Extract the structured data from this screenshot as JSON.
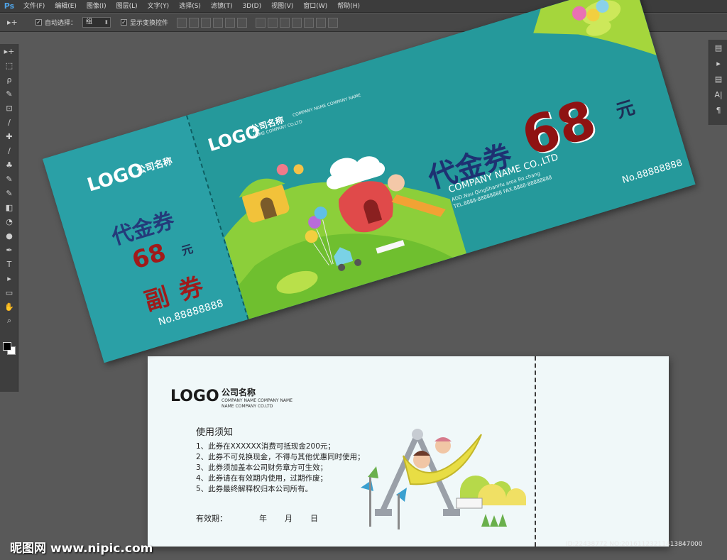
{
  "app": {
    "logo": "Ps"
  },
  "menu": [
    "文件(F)",
    "编辑(E)",
    "图像(I)",
    "图层(L)",
    "文字(Y)",
    "选择(S)",
    "滤镜(T)",
    "3D(D)",
    "视图(V)",
    "窗口(W)",
    "帮助(H)"
  ],
  "options": {
    "tool_glyph": "▸+",
    "auto_select_label": "自动选择：",
    "auto_select_value": "组",
    "show_transform_label": "显示变换控件",
    "check_mark": "✓"
  },
  "toolbar_glyphs": [
    "▸+",
    "⬚",
    "ρ",
    "✎",
    "⊡",
    "∕",
    "✚",
    "∕",
    "♣",
    "✎",
    "✎",
    "◧",
    "◔",
    "●",
    "✒",
    "T",
    "▸",
    "▭",
    "✋",
    "⌕"
  ],
  "right_panel_glyphs": [
    "▤",
    "▸",
    "▤",
    "A|",
    "¶"
  ],
  "ticket": {
    "stub": {
      "logo": "LOGO",
      "logo_cn": "公司名称",
      "title": "代金券",
      "amount": "68",
      "yuan": "元",
      "fu": "副券",
      "number": "No.88888888"
    },
    "main": {
      "logo": "LOGO",
      "logo_cn": "公司名称",
      "logo_en1": "COMPANY NAME COMPANY NAME",
      "logo_en2": "NAME COMPANY CO.LTD",
      "title": "代金券",
      "amount": "68",
      "yuan": "元",
      "company": "COMPANY NAME CO.,LTD",
      "addr": "ADD.Nou QingShanHu aroa Ro.chang",
      "tel": "TEL.8888-88888888   FAX.8888-88888888",
      "number": "No.88888888"
    }
  },
  "back": {
    "logo": "LOGO",
    "logo_cn": "公司名称",
    "logo_en1": "COMPANY NAME COMPANY NAME",
    "logo_en2": "NAME COMPANY CO.LTD",
    "notice_title": "使用须知",
    "rules": [
      "1、此券在XXXXXX消费可抵现金200元；",
      "2、此券不可兑换现金，不得与其他优惠同时使用；",
      "3、此券须加盖本公司财务章方可生效；",
      "4、此券请在有效期内使用，过期作废；",
      "5、此券最终解释权归本公司所有。"
    ],
    "validity_label": "有效期：",
    "validity_year": "年",
    "validity_month": "月",
    "validity_day": "日"
  },
  "watermark": {
    "left": "昵图网 www.nipic.com",
    "right": "ID:22438772 NO:20161123211413847000"
  },
  "colors": {
    "ticket_teal": "#25999b",
    "stub_teal": "#2aa0a6",
    "title_blue": "#1e3172",
    "amount_red": "#8f1212",
    "back_bg": "#f0f8f9"
  }
}
